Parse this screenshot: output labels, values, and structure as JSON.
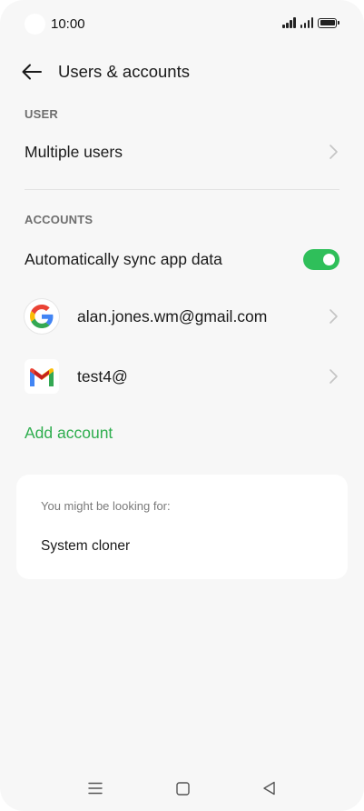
{
  "status_bar": {
    "time": "10:00"
  },
  "header": {
    "title": "Users & accounts",
    "back_icon": "arrow-left-icon"
  },
  "user_section": {
    "label": "USER",
    "items": [
      {
        "label": "Multiple users",
        "icon": "chevron-right-icon"
      }
    ]
  },
  "accounts_section": {
    "label": "ACCOUNTS",
    "auto_sync": {
      "label": "Automatically sync app data",
      "enabled": true
    },
    "accounts": [
      {
        "label": "alan.jones.wm@gmail.com",
        "icon": "google-icon"
      },
      {
        "label": "test4@",
        "icon": "gmail-icon"
      }
    ],
    "add_account_label": "Add account"
  },
  "suggestions": {
    "heading": "You might be looking for:",
    "items": [
      {
        "label": "System cloner"
      }
    ]
  },
  "nav_bar": {
    "items": [
      "menu-icon",
      "home-icon",
      "back-icon"
    ]
  },
  "colors": {
    "accent": "#2fae4f",
    "toggle_on": "#2fbf5a",
    "background": "#f7f7f7",
    "card": "#ffffff"
  }
}
